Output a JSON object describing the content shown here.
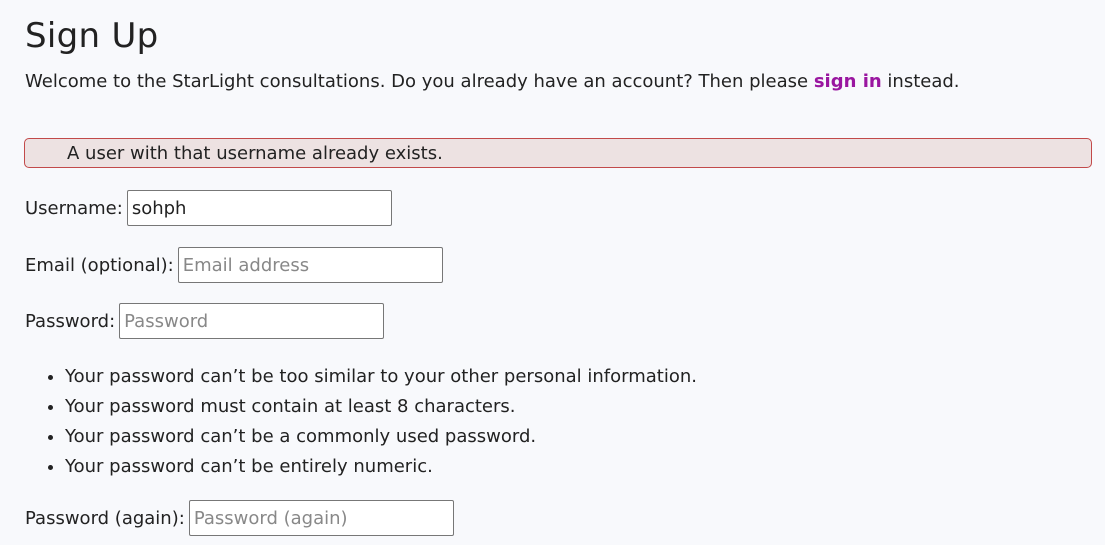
{
  "page": {
    "title": "Sign Up",
    "intro_before": "Welcome to the StarLight consultations. Do you already have an account? Then please ",
    "sign_in_link": "sign in",
    "intro_after": " instead."
  },
  "error": "A user with that username already exists.",
  "form": {
    "username": {
      "label": "Username:",
      "value": "sohph"
    },
    "email": {
      "label": "Email (optional):",
      "placeholder": "Email address"
    },
    "password": {
      "label": "Password:",
      "placeholder": "Password"
    },
    "password_help": [
      "Your password can’t be too similar to your other personal information.",
      "Your password must contain at least 8 characters.",
      "Your password can’t be a commonly used password.",
      "Your password can’t be entirely numeric."
    ],
    "password2": {
      "label": "Password (again):",
      "placeholder": "Password (again)"
    }
  }
}
